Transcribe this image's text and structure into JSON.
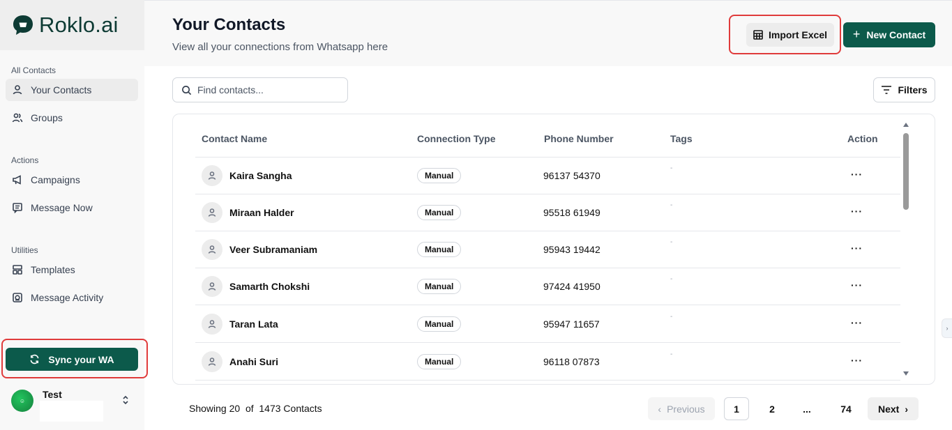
{
  "brand": {
    "name": "Roklo.ai",
    "color": "#0c5a4b"
  },
  "sidebar": {
    "sections": [
      {
        "title": "All Contacts",
        "items": [
          {
            "label": "Your Contacts",
            "icon": "user-icon"
          },
          {
            "label": "Groups",
            "icon": "users-icon"
          }
        ]
      },
      {
        "title": "Actions",
        "items": [
          {
            "label": "Campaigns",
            "icon": "megaphone-icon"
          },
          {
            "label": "Message Now",
            "icon": "message-square-icon"
          }
        ]
      },
      {
        "title": "Utilities",
        "items": [
          {
            "label": "Templates",
            "icon": "layout-icon"
          },
          {
            "label": "Message Activity",
            "icon": "activity-icon"
          }
        ]
      }
    ],
    "active_item": "Your Contacts",
    "sync_label": "Sync your WA",
    "user": {
      "name": "Test"
    }
  },
  "header": {
    "title": "Your Contacts",
    "subtitle": "View all your connections from Whatsapp here",
    "import_label": "Import Excel",
    "new_label": "New Contact"
  },
  "toolbar": {
    "search_placeholder": "Find contacts...",
    "filters_label": "Filters"
  },
  "table": {
    "columns": [
      "Contact Name",
      "Connection Type",
      "Phone Number",
      "Tags",
      "Action"
    ],
    "rows": [
      {
        "name": "Kaira Sangha",
        "type": "Manual",
        "phone": "96137 54370",
        "tags": "-",
        "action": "···"
      },
      {
        "name": "Miraan Halder",
        "type": "Manual",
        "phone": "95518 61949",
        "tags": "-",
        "action": "···"
      },
      {
        "name": "Veer Subramaniam",
        "type": "Manual",
        "phone": "95943 19442",
        "tags": "-",
        "action": "···"
      },
      {
        "name": "Samarth Chokshi",
        "type": "Manual",
        "phone": "97424 41950",
        "tags": "-",
        "action": "···"
      },
      {
        "name": "Taran Lata",
        "type": "Manual",
        "phone": "95947 11657",
        "tags": "-",
        "action": "···"
      },
      {
        "name": "Anahi Suri",
        "type": "Manual",
        "phone": "96118 07873",
        "tags": "-",
        "action": "···"
      }
    ]
  },
  "footer": {
    "showing_text": "Showing 20  of  1473 Contacts",
    "prev_label": "Previous",
    "pages": [
      "1",
      "2",
      "...",
      "74"
    ],
    "current_page": "1",
    "next_label": "Next"
  },
  "colors": {
    "accent": "#0c5a4b",
    "highlight_outline": "#e03b3b"
  }
}
